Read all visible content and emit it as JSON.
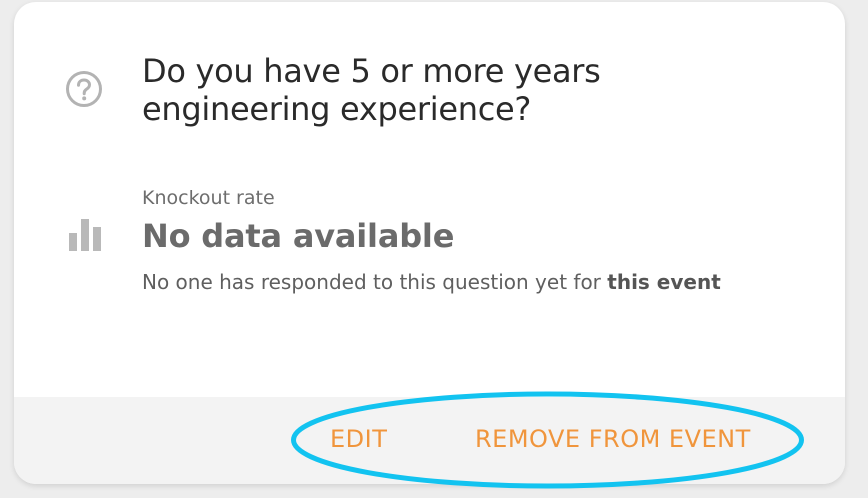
{
  "question": {
    "text_line1": "Do you have 5 or more years",
    "text_line2": "engineering experience?"
  },
  "stats": {
    "label": "Knockout rate",
    "value": "No data available",
    "note_prefix": "No one has responded to this question yet for ",
    "note_emphasis": "this event"
  },
  "actions": {
    "edit_label": "EDIT",
    "remove_label": "REMOVE FROM EVENT"
  },
  "colors": {
    "accent": "#f0953c",
    "highlight": "#12c3f0"
  },
  "icons": {
    "question": "help-circle-icon",
    "stats": "bar-chart-icon"
  }
}
